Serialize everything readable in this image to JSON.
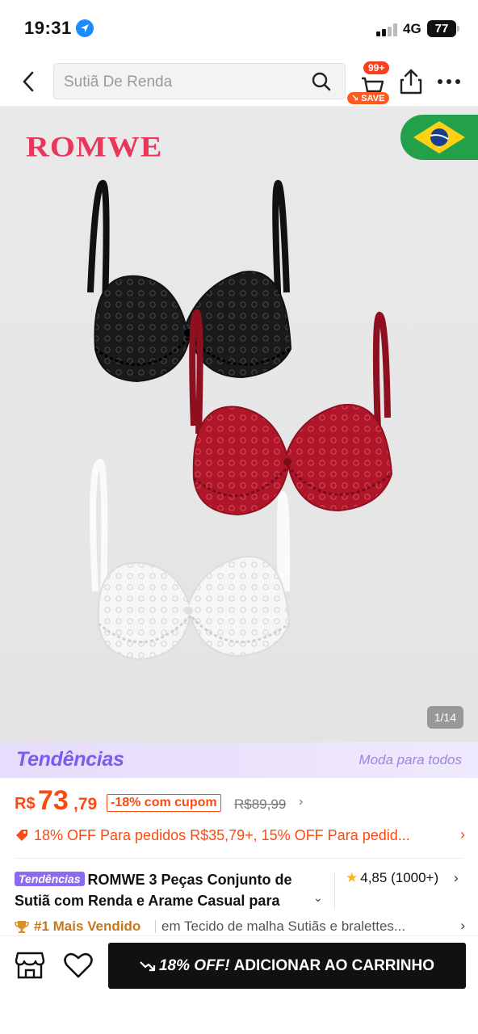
{
  "status_bar": {
    "time": "19:31",
    "network": "4G",
    "battery": "77"
  },
  "header": {
    "search_value": "Sutiã De Renda",
    "cart_count": "99+",
    "cart_save_label": "SAVE"
  },
  "gallery": {
    "brand": "ROMWE",
    "counter": "1/14",
    "flag": "brazil-flag"
  },
  "trends": {
    "logo": "Tendências",
    "tagline": "Moda para todos"
  },
  "price": {
    "currency": "R$",
    "integer": "73",
    "cents": ",79",
    "coupon": "-18% com cupom",
    "original": "R$89,99"
  },
  "promo": {
    "text": "18% OFF Para pedidos R$35,79+,  15% OFF Para pedid..."
  },
  "product": {
    "badge": "Tendências",
    "title": "ROMWE 3 Peças Conjunto de Sutiã com Renda e Arame Casual para",
    "rating": "4,85",
    "reviews": "(1000+)"
  },
  "best_seller": {
    "rank": "#1 Mais Vendido",
    "category": "em Tecido de malha Sutiãs e bralettes..."
  },
  "bottom": {
    "discount": "18% OFF!",
    "add_to_cart": "ADICIONAR AO CARRINHO"
  },
  "colors": {
    "accent": "#fa4a12",
    "trends_purple": "#8b6cf1",
    "brand_pink": "#e8375a",
    "bra_black": "#1a1a1a",
    "bra_red": "#b0162a",
    "bra_white": "#f6f6f6"
  }
}
